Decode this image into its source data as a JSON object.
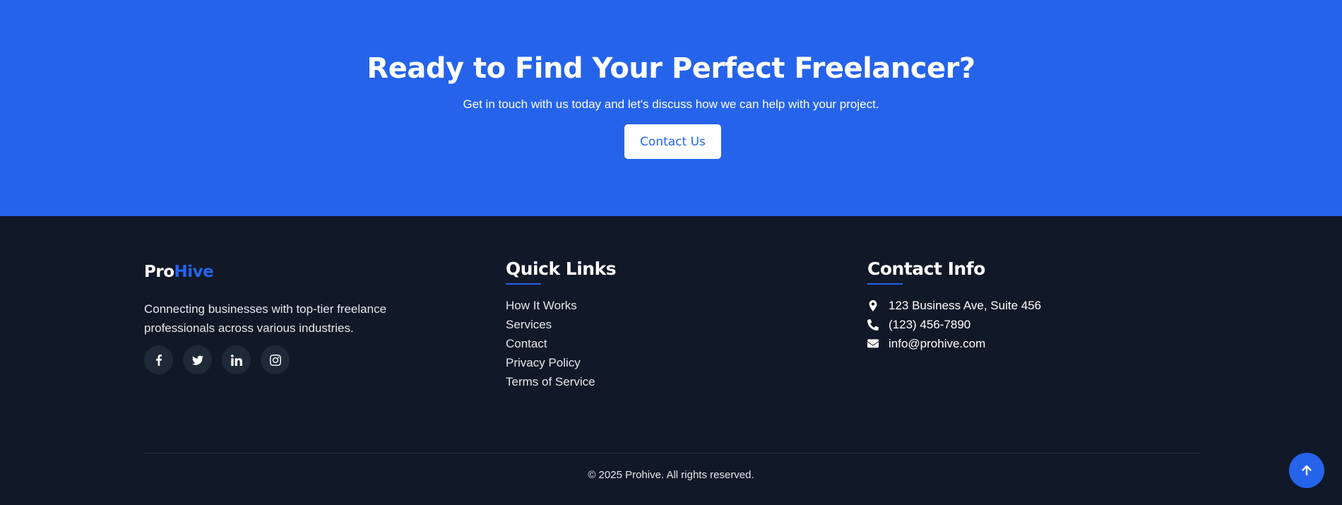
{
  "cta": {
    "title": "Ready to Find Your Perfect Freelancer?",
    "subtitle": "Get in touch with us today and let's discuss how we can help with your project.",
    "button_label": "Contact Us"
  },
  "brand": {
    "logo_part1": "Pro",
    "logo_part2": "Hive",
    "description": "Connecting businesses with top-tier freelance professionals across various industries.",
    "socials": [
      "facebook-icon",
      "twitter-icon",
      "linkedin-icon",
      "instagram-icon"
    ]
  },
  "quick_links": {
    "title": "Quick Links",
    "items": [
      "How It Works",
      "Services",
      "Contact",
      "Privacy Policy",
      "Terms of Service"
    ]
  },
  "contact_info": {
    "title": "Contact Info",
    "address": "123 Business Ave, Suite 456",
    "phone": "(123) 456-7890",
    "email": "info@prohive.com"
  },
  "copyright": "© 2025 Prohive. All rights reserved.",
  "colors": {
    "accent": "#2563eb",
    "footer_bg": "#111827",
    "social_bg": "#1f2937"
  },
  "icons": {
    "address": "map-pin-icon",
    "phone": "phone-icon",
    "email": "envelope-icon",
    "scroll_top": "arrow-up-icon"
  }
}
